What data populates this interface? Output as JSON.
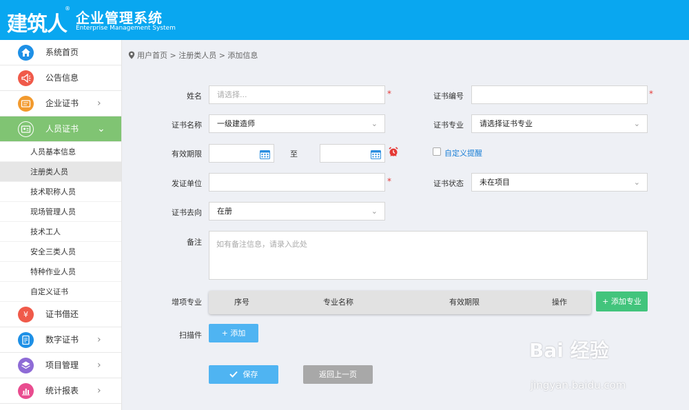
{
  "header": {
    "logo_main": "建筑人",
    "logo_reg": "®",
    "logo_cn": "企业管理系统",
    "logo_en": "Enterprise Management System",
    "bg_color": "#09a7f0"
  },
  "sidebar": {
    "items": [
      {
        "label": "系统首页",
        "icon": "home-icon",
        "color": "#1e90e6"
      },
      {
        "label": "公告信息",
        "icon": "megaphone-icon",
        "color": "#f05a4a"
      },
      {
        "label": "企业证书",
        "icon": "certificate-icon",
        "color": "#f29a2e"
      },
      {
        "label": "人员证书",
        "icon": "id-card-icon",
        "color": "#80c473"
      },
      {
        "label": "证书借还",
        "icon": "yuan-hand-icon",
        "color": "#f05a4a"
      },
      {
        "label": "数字证书",
        "icon": "document-icon",
        "color": "#1e90e6"
      },
      {
        "label": "项目管理",
        "icon": "layers-icon",
        "color": "#8e6bd6"
      },
      {
        "label": "统计报表",
        "icon": "bar-chart-icon",
        "color": "#e94c8f"
      }
    ],
    "sub_items": [
      "人员基本信息",
      "注册类人员",
      "技术职称人员",
      "现场管理人员",
      "技术工人",
      "安全三类人员",
      "特种作业人员",
      "自定义证书"
    ]
  },
  "breadcrumb": "用户首页 > 注册类人员 > 添加信息",
  "form": {
    "name_label": "姓名",
    "name_placeholder": "请选择...",
    "cert_no_label": "证书编号",
    "cert_name_label": "证书名称",
    "cert_name_value": "一级建造师",
    "cert_major_label": "证书专业",
    "cert_major_value": "请选择证书专业",
    "validity_label": "有效期限",
    "to_label": "至",
    "custom_remind": "自定义提醒",
    "issuer_label": "发证单位",
    "cert_status_label": "证书状态",
    "cert_status_value": "未在项目",
    "cert_dest_label": "证书去向",
    "cert_dest_value": "在册",
    "remark_label": "备注",
    "remark_placeholder": "如有备注信息，请录入此处",
    "extra_major_label": "增项专业",
    "scan_label": "扫描件",
    "required_mark": "*"
  },
  "grid": {
    "columns": [
      "序号",
      "专业名称",
      "有效期限",
      "操作"
    ]
  },
  "buttons": {
    "add_major": "+ 添加专业",
    "add_scan": "+ 添加",
    "save": "保存",
    "back": "返回上一页"
  },
  "watermark": {
    "brand": "Bai 经验",
    "url": "jingyan.baidu.com"
  }
}
